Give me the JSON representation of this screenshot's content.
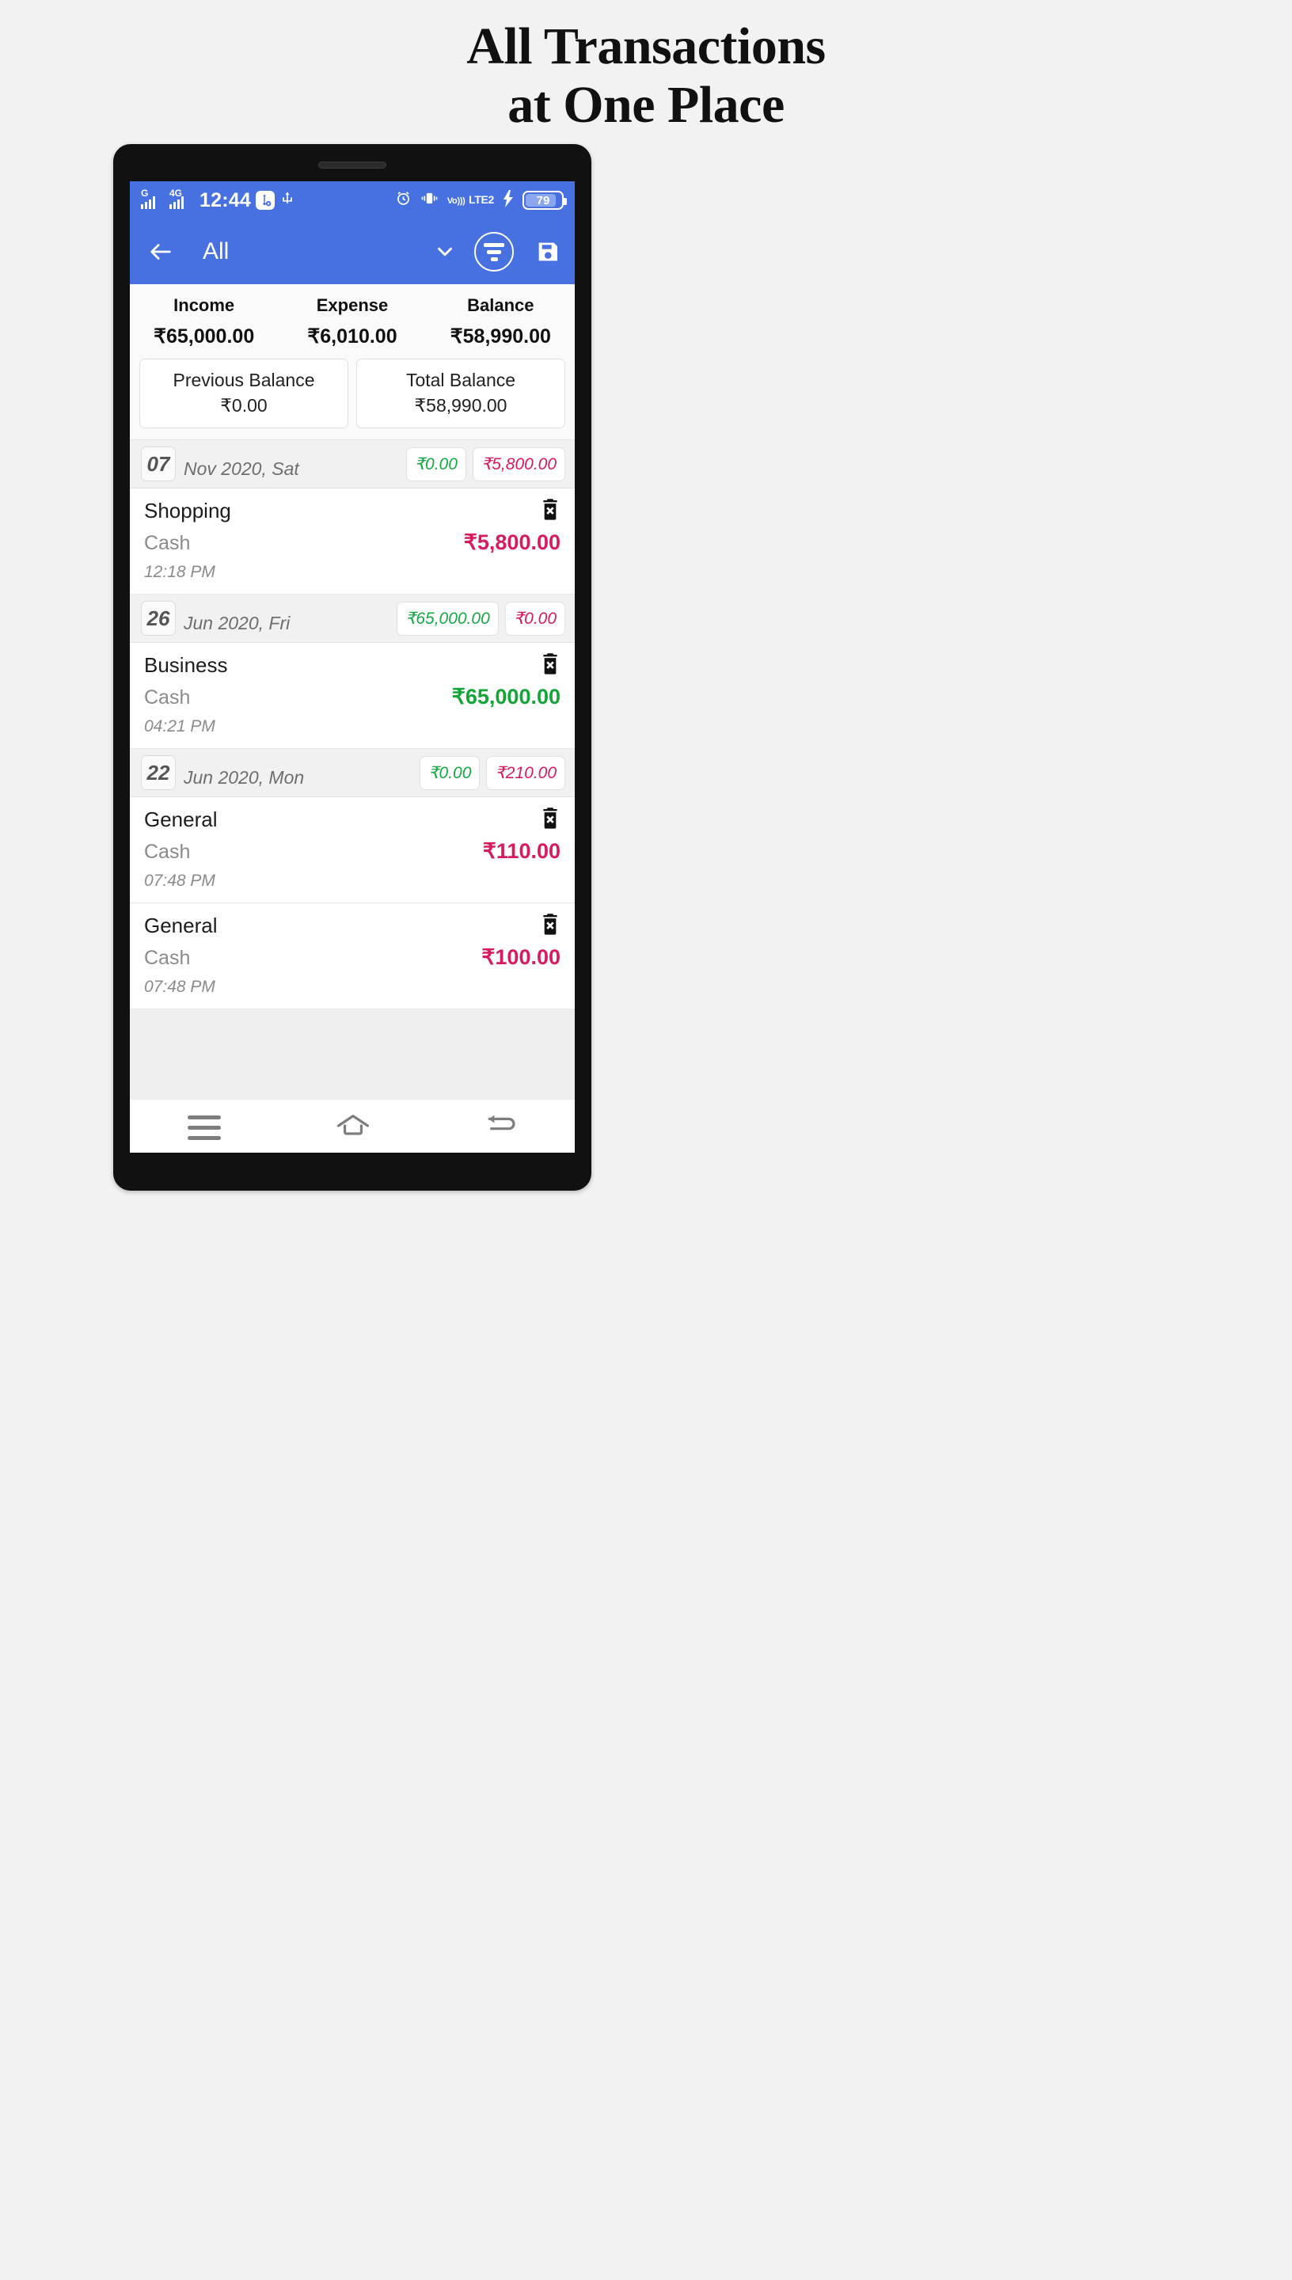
{
  "headline": {
    "line1": "All Transactions",
    "line2": "at One Place"
  },
  "statusbar": {
    "network_label_1": "G",
    "network_label_2": "4G",
    "time": "12:44",
    "usb_config_icon": "usb-settings-icon",
    "usb_icon": "usb-icon",
    "alarm_icon": "alarm-clock-icon",
    "vibrate_icon": "vibrate-icon",
    "volte_top": "Vo)))",
    "volte_bottom": "LTE2",
    "charging_icon": "charging-bolt-icon",
    "battery_level": "79"
  },
  "appbar": {
    "back_icon": "back-arrow-icon",
    "title": "All",
    "dropdown_icon": "chevron-down-icon",
    "filter_icon": "filter-icon",
    "save_icon": "save-floppy-icon"
  },
  "summary": {
    "columns": [
      {
        "label": "Income",
        "value": "₹65,000.00"
      },
      {
        "label": "Expense",
        "value": "₹6,010.00"
      },
      {
        "label": "Balance",
        "value": "₹58,990.00"
      }
    ],
    "cards": [
      {
        "title": "Previous Balance",
        "amount": "₹0.00"
      },
      {
        "title": "Total Balance",
        "amount": "₹58,990.00"
      }
    ]
  },
  "groups": [
    {
      "day": "07",
      "date": "Nov 2020, Sat",
      "income_badge": "₹0.00",
      "expense_badge": "₹5,800.00",
      "transactions": [
        {
          "title": "Shopping",
          "account": "Cash",
          "amount": "₹5,800.00",
          "type": "expense",
          "time": "12:18 PM",
          "delete_icon": "delete-trash-icon"
        }
      ]
    },
    {
      "day": "26",
      "date": "Jun 2020, Fri",
      "income_badge": "₹65,000.00",
      "expense_badge": "₹0.00",
      "transactions": [
        {
          "title": "Business",
          "account": "Cash",
          "amount": "₹65,000.00",
          "type": "income",
          "time": "04:21 PM",
          "delete_icon": "delete-trash-icon"
        }
      ]
    },
    {
      "day": "22",
      "date": "Jun 2020, Mon",
      "income_badge": "₹0.00",
      "expense_badge": "₹210.00",
      "transactions": [
        {
          "title": "General",
          "account": "Cash",
          "amount": "₹110.00",
          "type": "expense",
          "time": "07:48 PM",
          "delete_icon": "delete-trash-icon"
        },
        {
          "title": "General",
          "account": "Cash",
          "amount": "₹100.00",
          "type": "expense",
          "time": "07:48 PM",
          "delete_icon": "delete-trash-icon"
        }
      ]
    }
  ],
  "navbar": {
    "menu_icon": "menu-hamburger-icon",
    "home_icon": "home-icon",
    "back_icon": "back-nav-icon"
  },
  "colors": {
    "primary": "#4770e0",
    "income": "#13a538",
    "expense": "#d81b60",
    "page_bg": "#f2f2f2"
  }
}
